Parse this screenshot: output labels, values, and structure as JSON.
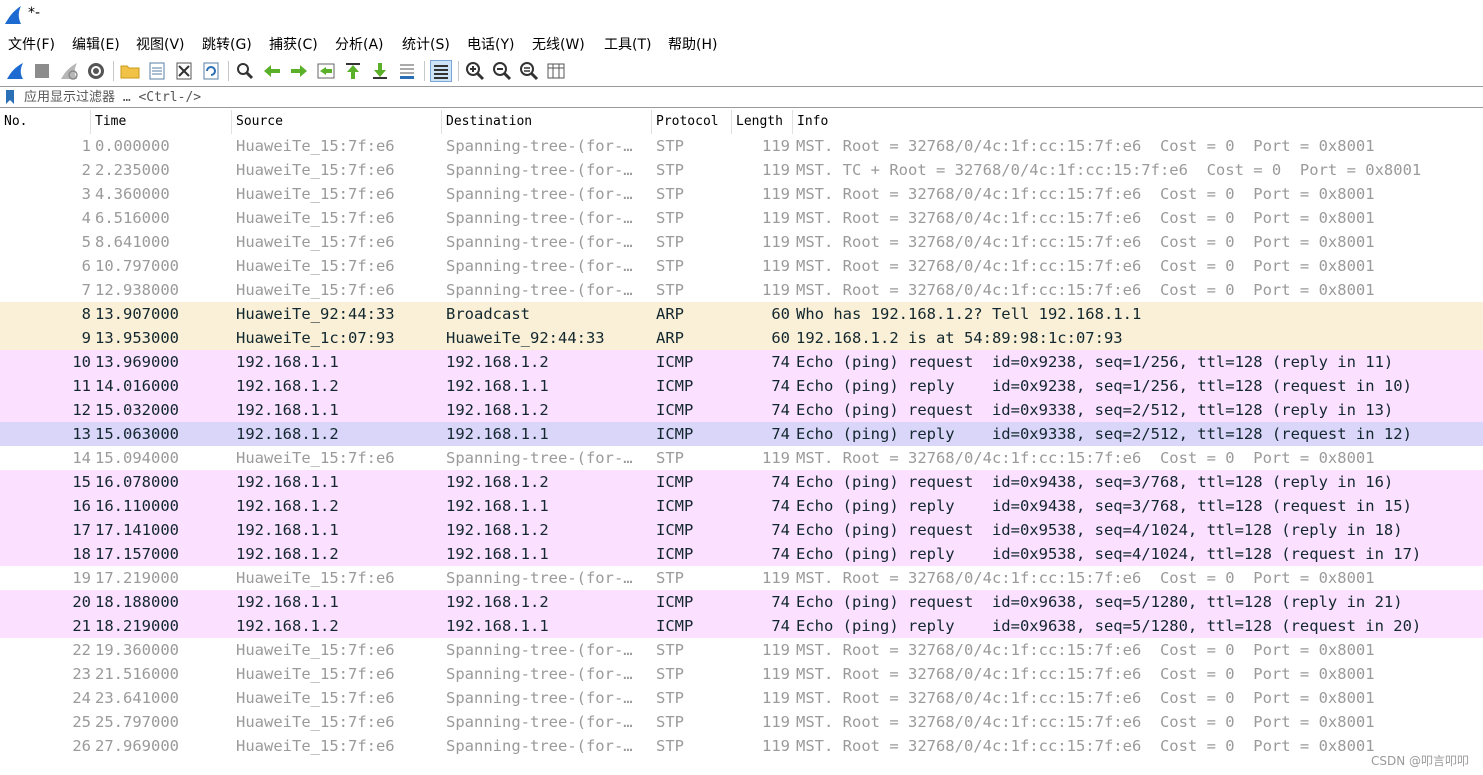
{
  "window": {
    "title": "*-"
  },
  "menu": [
    "文件(F)",
    "编辑(E)",
    "视图(V)",
    "跳转(G)",
    "捕获(C)",
    "分析(A)",
    "统计(S)",
    "电话(Y)",
    "无线(W)",
    "工具(T)",
    "帮助(H)"
  ],
  "toolbar": {
    "icons": [
      "shark-fin-start-icon",
      "stop-square-icon",
      "restart-fin-icon",
      "capture-options-gear-icon",
      "open-folder-icon",
      "save-file-icon",
      "close-file-icon",
      "reload-icon",
      "find-magnifier-icon",
      "go-back-arrow-icon",
      "go-forward-arrow-icon",
      "go-to-packet-icon",
      "go-first-packet-icon",
      "go-last-packet-icon",
      "auto-scroll-icon",
      "colorize-lines-icon",
      "zoom-in-icon",
      "zoom-out-icon",
      "zoom-normal-icon",
      "resize-columns-icon"
    ]
  },
  "filter": {
    "placeholder": "应用显示过滤器 … <Ctrl-/>"
  },
  "columns": {
    "no": "No.",
    "time": "Time",
    "source": "Source",
    "destination": "Destination",
    "protocol": "Protocol",
    "length": "Length",
    "info": "Info"
  },
  "colors": {
    "stp": "#9a9a9a",
    "arp_bg": "#faf0d7",
    "icmp_bg": "#fce0ff",
    "selected_bg": "#dad6fa"
  },
  "packets": [
    {
      "no": "1",
      "time": "0.000000",
      "src": "HuaweiTe_15:7f:e6",
      "dst": "Spanning-tree-(for-…",
      "proto": "STP",
      "len": "119",
      "info": "MST. Root = 32768/0/4c:1f:cc:15:7f:e6  Cost = 0  Port = 0x8001",
      "cls": "stp"
    },
    {
      "no": "2",
      "time": "2.235000",
      "src": "HuaweiTe_15:7f:e6",
      "dst": "Spanning-tree-(for-…",
      "proto": "STP",
      "len": "119",
      "info": "MST. TC + Root = 32768/0/4c:1f:cc:15:7f:e6  Cost = 0  Port = 0x8001",
      "cls": "stp"
    },
    {
      "no": "3",
      "time": "4.360000",
      "src": "HuaweiTe_15:7f:e6",
      "dst": "Spanning-tree-(for-…",
      "proto": "STP",
      "len": "119",
      "info": "MST. Root = 32768/0/4c:1f:cc:15:7f:e6  Cost = 0  Port = 0x8001",
      "cls": "stp"
    },
    {
      "no": "4",
      "time": "6.516000",
      "src": "HuaweiTe_15:7f:e6",
      "dst": "Spanning-tree-(for-…",
      "proto": "STP",
      "len": "119",
      "info": "MST. Root = 32768/0/4c:1f:cc:15:7f:e6  Cost = 0  Port = 0x8001",
      "cls": "stp"
    },
    {
      "no": "5",
      "time": "8.641000",
      "src": "HuaweiTe_15:7f:e6",
      "dst": "Spanning-tree-(for-…",
      "proto": "STP",
      "len": "119",
      "info": "MST. Root = 32768/0/4c:1f:cc:15:7f:e6  Cost = 0  Port = 0x8001",
      "cls": "stp"
    },
    {
      "no": "6",
      "time": "10.797000",
      "src": "HuaweiTe_15:7f:e6",
      "dst": "Spanning-tree-(for-…",
      "proto": "STP",
      "len": "119",
      "info": "MST. Root = 32768/0/4c:1f:cc:15:7f:e6  Cost = 0  Port = 0x8001",
      "cls": "stp"
    },
    {
      "no": "7",
      "time": "12.938000",
      "src": "HuaweiTe_15:7f:e6",
      "dst": "Spanning-tree-(for-…",
      "proto": "STP",
      "len": "119",
      "info": "MST. Root = 32768/0/4c:1f:cc:15:7f:e6  Cost = 0  Port = 0x8001",
      "cls": "stp"
    },
    {
      "no": "8",
      "time": "13.907000",
      "src": "HuaweiTe_92:44:33",
      "dst": "Broadcast",
      "proto": "ARP",
      "len": "60",
      "info": "Who has 192.168.1.2? Tell 192.168.1.1",
      "cls": "arp"
    },
    {
      "no": "9",
      "time": "13.953000",
      "src": "HuaweiTe_1c:07:93",
      "dst": "HuaweiTe_92:44:33",
      "proto": "ARP",
      "len": "60",
      "info": "192.168.1.2 is at 54:89:98:1c:07:93",
      "cls": "arp"
    },
    {
      "no": "10",
      "time": "13.969000",
      "src": "192.168.1.1",
      "dst": "192.168.1.2",
      "proto": "ICMP",
      "len": "74",
      "info": "Echo (ping) request  id=0x9238, seq=1/256, ttl=128 (reply in 11)",
      "cls": "icmp"
    },
    {
      "no": "11",
      "time": "14.016000",
      "src": "192.168.1.2",
      "dst": "192.168.1.1",
      "proto": "ICMP",
      "len": "74",
      "info": "Echo (ping) reply    id=0x9238, seq=1/256, ttl=128 (request in 10)",
      "cls": "icmp"
    },
    {
      "no": "12",
      "time": "15.032000",
      "src": "192.168.1.1",
      "dst": "192.168.1.2",
      "proto": "ICMP",
      "len": "74",
      "info": "Echo (ping) request  id=0x9338, seq=2/512, ttl=128 (reply in 13)",
      "cls": "icmp"
    },
    {
      "no": "13",
      "time": "15.063000",
      "src": "192.168.1.2",
      "dst": "192.168.1.1",
      "proto": "ICMP",
      "len": "74",
      "info": "Echo (ping) reply    id=0x9338, seq=2/512, ttl=128 (request in 12)",
      "cls": "selected"
    },
    {
      "no": "14",
      "time": "15.094000",
      "src": "HuaweiTe_15:7f:e6",
      "dst": "Spanning-tree-(for-…",
      "proto": "STP",
      "len": "119",
      "info": "MST. Root = 32768/0/4c:1f:cc:15:7f:e6  Cost = 0  Port = 0x8001",
      "cls": "stp"
    },
    {
      "no": "15",
      "time": "16.078000",
      "src": "192.168.1.1",
      "dst": "192.168.1.2",
      "proto": "ICMP",
      "len": "74",
      "info": "Echo (ping) request  id=0x9438, seq=3/768, ttl=128 (reply in 16)",
      "cls": "icmp"
    },
    {
      "no": "16",
      "time": "16.110000",
      "src": "192.168.1.2",
      "dst": "192.168.1.1",
      "proto": "ICMP",
      "len": "74",
      "info": "Echo (ping) reply    id=0x9438, seq=3/768, ttl=128 (request in 15)",
      "cls": "icmp"
    },
    {
      "no": "17",
      "time": "17.141000",
      "src": "192.168.1.1",
      "dst": "192.168.1.2",
      "proto": "ICMP",
      "len": "74",
      "info": "Echo (ping) request  id=0x9538, seq=4/1024, ttl=128 (reply in 18)",
      "cls": "icmp"
    },
    {
      "no": "18",
      "time": "17.157000",
      "src": "192.168.1.2",
      "dst": "192.168.1.1",
      "proto": "ICMP",
      "len": "74",
      "info": "Echo (ping) reply    id=0x9538, seq=4/1024, ttl=128 (request in 17)",
      "cls": "icmp"
    },
    {
      "no": "19",
      "time": "17.219000",
      "src": "HuaweiTe_15:7f:e6",
      "dst": "Spanning-tree-(for-…",
      "proto": "STP",
      "len": "119",
      "info": "MST. Root = 32768/0/4c:1f:cc:15:7f:e6  Cost = 0  Port = 0x8001",
      "cls": "stp"
    },
    {
      "no": "20",
      "time": "18.188000",
      "src": "192.168.1.1",
      "dst": "192.168.1.2",
      "proto": "ICMP",
      "len": "74",
      "info": "Echo (ping) request  id=0x9638, seq=5/1280, ttl=128 (reply in 21)",
      "cls": "icmp"
    },
    {
      "no": "21",
      "time": "18.219000",
      "src": "192.168.1.2",
      "dst": "192.168.1.1",
      "proto": "ICMP",
      "len": "74",
      "info": "Echo (ping) reply    id=0x9638, seq=5/1280, ttl=128 (request in 20)",
      "cls": "icmp"
    },
    {
      "no": "22",
      "time": "19.360000",
      "src": "HuaweiTe_15:7f:e6",
      "dst": "Spanning-tree-(for-…",
      "proto": "STP",
      "len": "119",
      "info": "MST. Root = 32768/0/4c:1f:cc:15:7f:e6  Cost = 0  Port = 0x8001",
      "cls": "stp"
    },
    {
      "no": "23",
      "time": "21.516000",
      "src": "HuaweiTe_15:7f:e6",
      "dst": "Spanning-tree-(for-…",
      "proto": "STP",
      "len": "119",
      "info": "MST. Root = 32768/0/4c:1f:cc:15:7f:e6  Cost = 0  Port = 0x8001",
      "cls": "stp"
    },
    {
      "no": "24",
      "time": "23.641000",
      "src": "HuaweiTe_15:7f:e6",
      "dst": "Spanning-tree-(for-…",
      "proto": "STP",
      "len": "119",
      "info": "MST. Root = 32768/0/4c:1f:cc:15:7f:e6  Cost = 0  Port = 0x8001",
      "cls": "stp"
    },
    {
      "no": "25",
      "time": "25.797000",
      "src": "HuaweiTe_15:7f:e6",
      "dst": "Spanning-tree-(for-…",
      "proto": "STP",
      "len": "119",
      "info": "MST. Root = 32768/0/4c:1f:cc:15:7f:e6  Cost = 0  Port = 0x8001",
      "cls": "stp"
    },
    {
      "no": "26",
      "time": "27.969000",
      "src": "HuaweiTe_15:7f:e6",
      "dst": "Spanning-tree-(for-…",
      "proto": "STP",
      "len": "119",
      "info": "MST. Root = 32768/0/4c:1f:cc:15:7f:e6  Cost = 0  Port = 0x8001",
      "cls": "stp"
    }
  ],
  "watermark": "CSDN @叩言叩叩"
}
